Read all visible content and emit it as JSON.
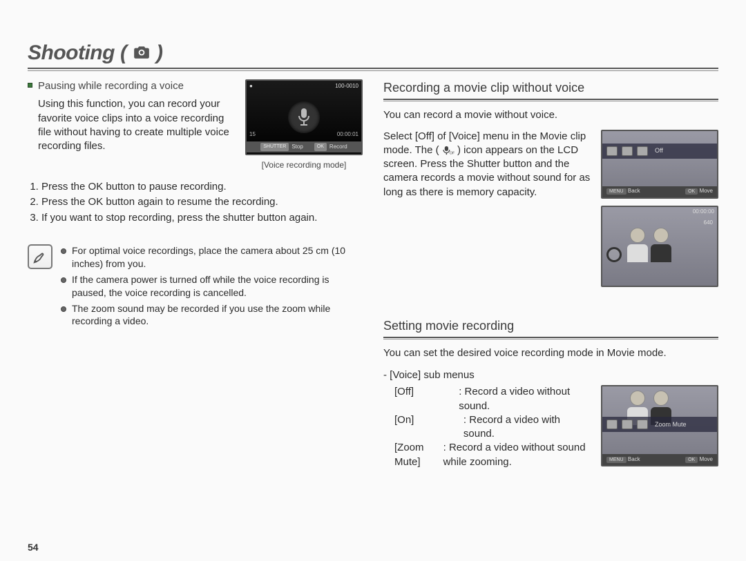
{
  "header": {
    "title": "Shooting"
  },
  "left": {
    "subhead": "Pausing while recording a voice",
    "para": "Using this function, you can record your favorite voice clips into a voice recording file without having to create multiple voice recording files.",
    "figure_caption": "[Voice recording mode]",
    "lcd": {
      "counter": "100-0010",
      "time_left": "15",
      "time_right": "00:00:01",
      "btn1_chip": "SHUTTER",
      "btn1": "Stop",
      "btn2_chip": "OK",
      "btn2": "Record"
    },
    "steps": [
      "Press the OK button to pause recording.",
      "Press the OK button again to resume the recording.",
      "If you want to stop recording, press the shutter button again."
    ],
    "tips": [
      "For optimal voice recordings, place the camera about 25 cm (10 inches) from you.",
      "If the camera power is turned off while the voice recording is paused, the voice recording is cancelled.",
      "The zoom sound may be recorded if you use the zoom while recording a video."
    ]
  },
  "right1": {
    "title": "Recording a movie clip without voice",
    "line1": "You can record a movie without voice.",
    "para_a": "Select [Off] of [Voice] menu in the Movie clip mode. The (",
    "para_b": ") icon appears on the LCD screen. Press the Shutter button and the camera records a movie without sound for as long as there is memory capacity.",
    "lcd_menu_label": "Off",
    "lcd_bottom_left_chip": "MENU",
    "lcd_bottom_left": "Back",
    "lcd_bottom_right_chip": "OK",
    "lcd_bottom_right": "Move",
    "lcd2_topright": "00:00:00",
    "lcd2_res": "640"
  },
  "right2": {
    "title": "Setting movie recording",
    "line1": "You can set the desired voice recording mode in Movie mode.",
    "submenu_header": "- [Voice] sub menus",
    "rows": [
      {
        "key": "[Off]",
        "val": "Record a video without sound."
      },
      {
        "key": "[On]",
        "val": "Record a video with sound."
      },
      {
        "key": "[Zoom Mute]",
        "val": "Record a video without sound while zooming."
      }
    ],
    "lcd_menu_label": "Zoom Mute",
    "lcd_bottom_left_chip": "MENU",
    "lcd_bottom_left": "Back",
    "lcd_bottom_right_chip": "OK",
    "lcd_bottom_right": "Move"
  },
  "page_number": "54"
}
